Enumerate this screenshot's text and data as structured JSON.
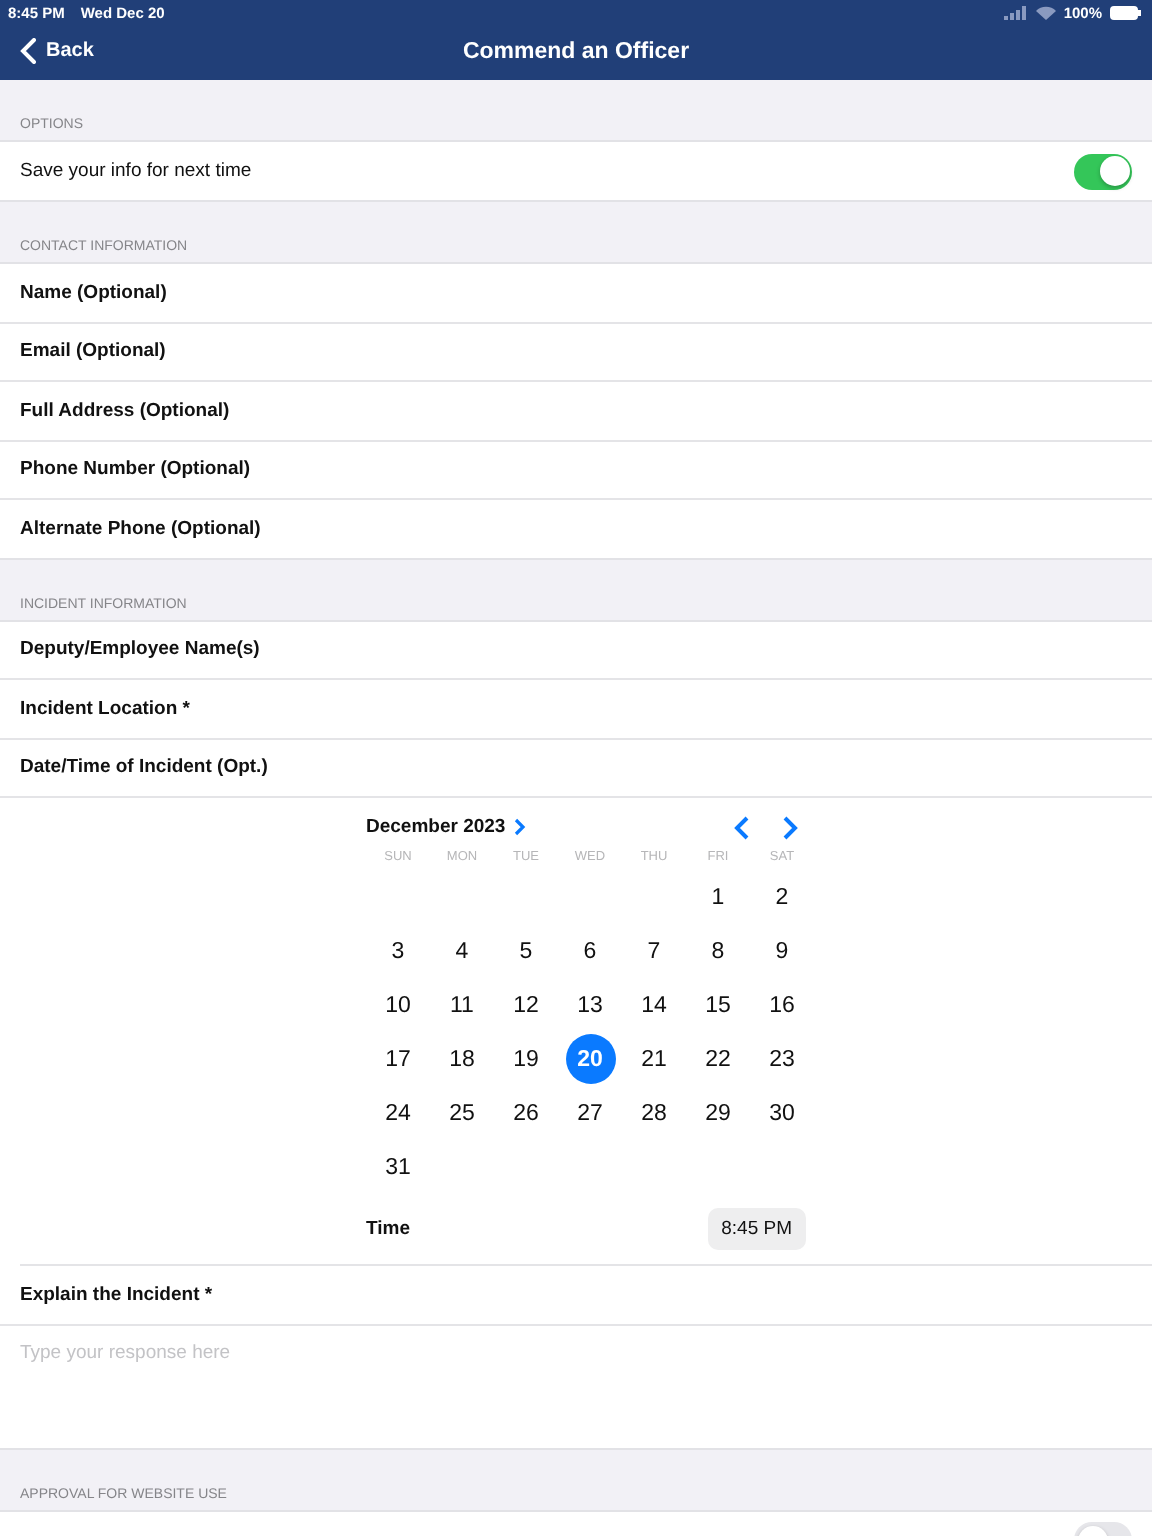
{
  "status_bar": {
    "time": "8:45 PM",
    "date": "Wed Dec 20",
    "battery": "100%"
  },
  "nav": {
    "back": "Back",
    "title": "Commend an Officer"
  },
  "sections": [
    {
      "header": "OPTIONS",
      "rows": [
        {
          "kind": "toggle",
          "label": "Save your info for next time",
          "on": true
        }
      ]
    },
    {
      "header": "CONTACT INFORMATION",
      "rows": [
        {
          "kind": "field",
          "label": "Name (Optional)"
        },
        {
          "kind": "field",
          "label": "Email (Optional)"
        },
        {
          "kind": "field",
          "label": "Full Address (Optional)"
        },
        {
          "kind": "field",
          "label": "Phone Number (Optional)"
        },
        {
          "kind": "field",
          "label": "Alternate Phone (Optional)"
        }
      ]
    },
    {
      "header": "INCIDENT INFORMATION",
      "rows": [
        {
          "kind": "field",
          "label": "Deputy/Employee Name(s)"
        },
        {
          "kind": "field",
          "label": "Incident Location *"
        },
        {
          "kind": "field",
          "label": "Date/Time of Incident (Opt.)"
        },
        {
          "kind": "calendar",
          "month": "December 2023",
          "weekdays": [
            "SUN",
            "MON",
            "TUE",
            "WED",
            "THU",
            "FRI",
            "SAT"
          ],
          "weeks": [
            {
              "kind": "first",
              "days": [
                {
                  "label": "1",
                  "selected": false
                },
                {
                  "label": "2",
                  "selected": false
                }
              ]
            },
            {
              "kind": "full",
              "days": [
                {
                  "label": "3",
                  "selected": false
                },
                {
                  "label": "4",
                  "selected": false
                },
                {
                  "label": "5",
                  "selected": false
                },
                {
                  "label": "6",
                  "selected": false
                },
                {
                  "label": "7",
                  "selected": false
                },
                {
                  "label": "8",
                  "selected": false
                },
                {
                  "label": "9",
                  "selected": false
                }
              ]
            },
            {
              "kind": "full",
              "days": [
                {
                  "label": "10",
                  "selected": false
                },
                {
                  "label": "11",
                  "selected": false
                },
                {
                  "label": "12",
                  "selected": false
                },
                {
                  "label": "13",
                  "selected": false
                },
                {
                  "label": "14",
                  "selected": false
                },
                {
                  "label": "15",
                  "selected": false
                },
                {
                  "label": "16",
                  "selected": false
                }
              ]
            },
            {
              "kind": "full",
              "days": [
                {
                  "label": "17",
                  "selected": false
                },
                {
                  "label": "18",
                  "selected": false
                },
                {
                  "label": "19",
                  "selected": false
                },
                {
                  "label": "20",
                  "selected": true
                },
                {
                  "label": "21",
                  "selected": false
                },
                {
                  "label": "22",
                  "selected": false
                },
                {
                  "label": "23",
                  "selected": false
                }
              ]
            },
            {
              "kind": "full",
              "days": [
                {
                  "label": "24",
                  "selected": false
                },
                {
                  "label": "25",
                  "selected": false
                },
                {
                  "label": "26",
                  "selected": false
                },
                {
                  "label": "27",
                  "selected": false
                },
                {
                  "label": "28",
                  "selected": false
                },
                {
                  "label": "29",
                  "selected": false
                },
                {
                  "label": "30",
                  "selected": false
                }
              ]
            },
            {
              "kind": "last",
              "days": [
                {
                  "label": "31",
                  "selected": false
                }
              ]
            }
          ],
          "time_label": "Time",
          "time": "8:45 PM"
        },
        {
          "kind": "field",
          "label": "Explain the Incident *"
        },
        {
          "kind": "textarea",
          "placeholder": "Type your response here"
        }
      ]
    },
    {
      "header": "APPROVAL FOR WEBSITE USE",
      "rows": [
        {
          "kind": "toggle_cut",
          "on": false
        }
      ]
    }
  ]
}
